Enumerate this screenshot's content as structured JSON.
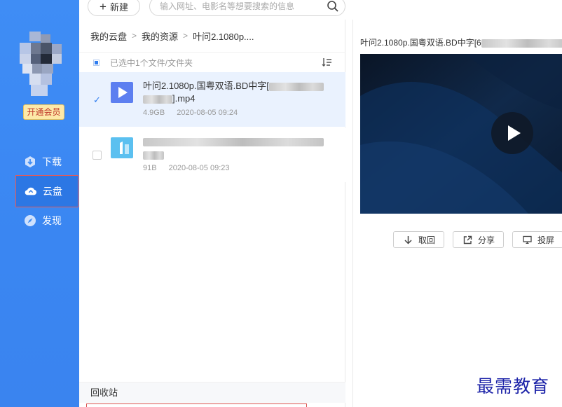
{
  "sidebar": {
    "vip_label": "开通会员",
    "nav": [
      {
        "label": "下载",
        "icon": "download-icon"
      },
      {
        "label": "云盘",
        "icon": "cloud-icon"
      },
      {
        "label": "发现",
        "icon": "compass-icon"
      }
    ]
  },
  "toolbar": {
    "new_label": "新建",
    "search_placeholder": "输入网址、电影名等想要搜索的信息"
  },
  "breadcrumb": [
    "我的云盘",
    "我的资源",
    "叶问2.1080p...."
  ],
  "selection_text": "已选中1个文件/文件夹",
  "files": [
    {
      "name_prefix": "叶问2.1080p.国粤双语.BD中字[",
      "name_suffix": "].mp4",
      "size": "4.9GB",
      "date": "2020-08-05 09:24",
      "selected": true
    },
    {
      "name_suffix": "",
      "size": "91B",
      "date": "2020-08-05 09:23",
      "selected": false
    }
  ],
  "recycle_label": "回收站",
  "preview": {
    "title": "叶问2.1080p.国粤双语.BD中字[6",
    "actions": [
      "取回",
      "分享",
      "投屏"
    ]
  },
  "watermark": "最需教育",
  "colors": {
    "sidebar": "#3f8df5",
    "accent": "#2f7df0",
    "selected_row": "#eaf2fe"
  }
}
